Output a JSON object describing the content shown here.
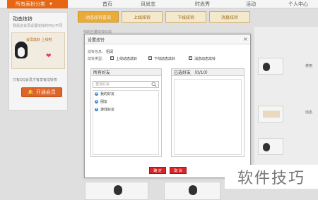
{
  "topnav": {
    "category": "所有表扮分类",
    "items": [
      "首页",
      "风尚志",
      "时尚秀",
      "活动",
      "个人中心"
    ]
  },
  "left": {
    "title": "动态炫铃",
    "subtitle": "我是这会员设置炫铃的何公不同",
    "member_badge": "会员炫铃 上线啦",
    "member_note": "只有QQ会员才有享有炫铃权",
    "vip_button": "开通会员"
  },
  "tabs": [
    "动态炫铃喜谣",
    "上线炫铃",
    "下线炫铃",
    "消息炫铃"
  ],
  "content_label": "你的已量炫铃好炫",
  "right_labels": [
    "使用",
    "动态"
  ],
  "dialog": {
    "title": "设置炫铃",
    "close": "×",
    "row1_label": "炫铃信息：",
    "row1_value": "招阔",
    "row2_label": "炫铃类型：",
    "options": [
      {
        "label": "上线动态炫铃",
        "checked": true
      },
      {
        "label": "下线动态炫铃",
        "checked": true
      },
      {
        "label": "消息动态炫铃",
        "checked": true
      }
    ],
    "friends_panel_title": "所有好友",
    "search_placeholder": "查找好友",
    "tree": [
      "我的好友",
      "朋友",
      "游戏好友"
    ],
    "selected_panel_title": "已选好友 （0/10）",
    "ok": "确 定",
    "cancel": "取 消"
  },
  "watermark": "软件技巧"
}
